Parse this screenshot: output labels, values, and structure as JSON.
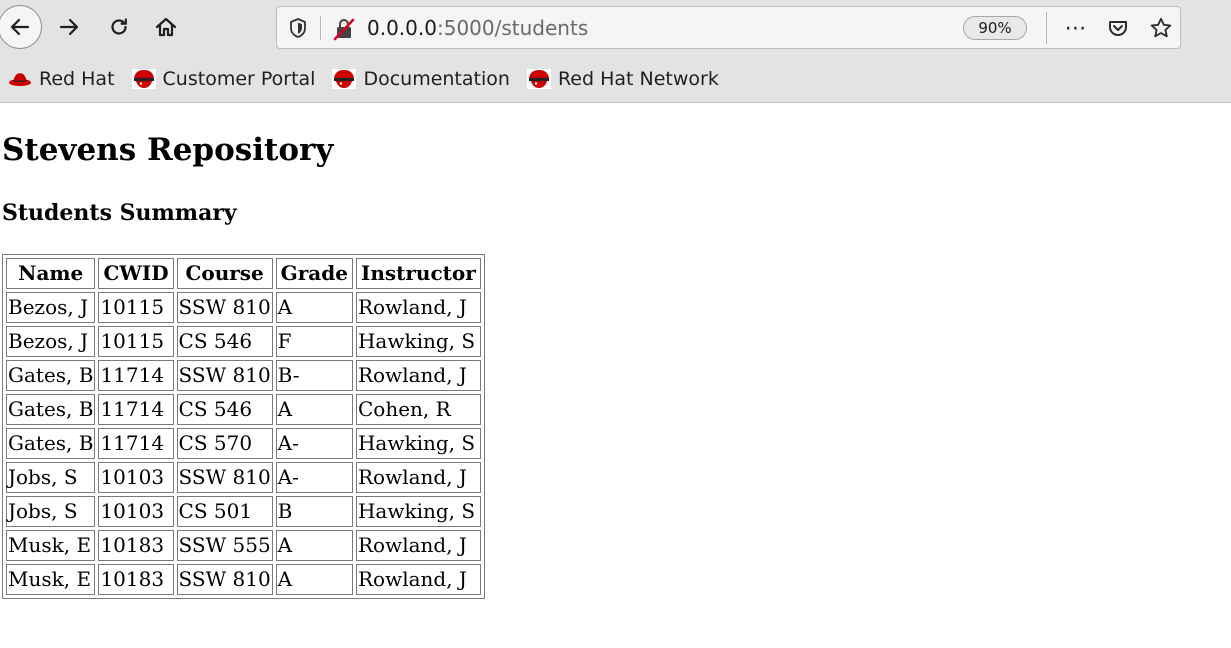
{
  "browser": {
    "url_host": "0.0.0.0",
    "url_path": ":5000/students",
    "zoom": "90%",
    "bookmarks": [
      {
        "label": "Red Hat",
        "icon": "redhat-hat-icon"
      },
      {
        "label": "Customer Portal",
        "icon": "redhat-shadowman-icon"
      },
      {
        "label": "Documentation",
        "icon": "redhat-shadowman-icon"
      },
      {
        "label": "Red Hat Network",
        "icon": "redhat-shadowman-icon"
      }
    ],
    "colors": {
      "redhat": "#cc0000"
    }
  },
  "page": {
    "title": "Stevens Repository",
    "subtitle": "Students Summary",
    "table": {
      "headers": [
        "Name",
        "CWID",
        "Course",
        "Grade",
        "Instructor"
      ],
      "rows": [
        [
          "Bezos, J",
          "10115",
          "SSW 810",
          "A",
          "Rowland, J"
        ],
        [
          "Bezos, J",
          "10115",
          "CS 546",
          "F",
          "Hawking, S"
        ],
        [
          "Gates, B",
          "11714",
          "SSW 810",
          "B-",
          "Rowland, J"
        ],
        [
          "Gates, B",
          "11714",
          "CS 546",
          "A",
          "Cohen, R"
        ],
        [
          "Gates, B",
          "11714",
          "CS 570",
          "A-",
          "Hawking, S"
        ],
        [
          "Jobs, S",
          "10103",
          "SSW 810",
          "A-",
          "Rowland, J"
        ],
        [
          "Jobs, S",
          "10103",
          "CS 501",
          "B",
          "Hawking, S"
        ],
        [
          "Musk, E",
          "10183",
          "SSW 555",
          "A",
          "Rowland, J"
        ],
        [
          "Musk, E",
          "10183",
          "SSW 810",
          "A",
          "Rowland, J"
        ]
      ]
    }
  }
}
